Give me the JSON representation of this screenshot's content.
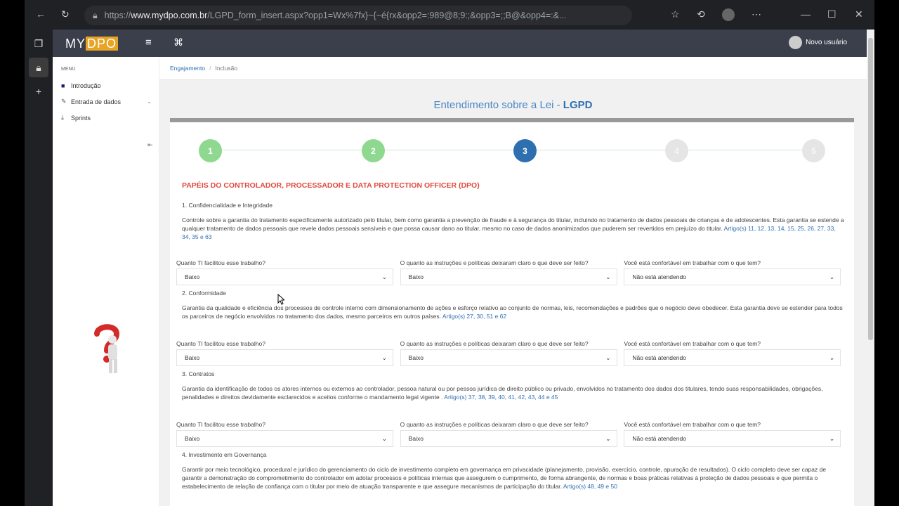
{
  "browser": {
    "url_prefix": "https://",
    "url_host": "www.mydpo.com.br",
    "url_rest": "/LGPD_form_insert.aspx?opp1=Wx%7fx}~{~é{rx&opp2=:989@8;9:;&opp3=;;B@&opp4=:&...",
    "icons": [
      "back-icon",
      "reload-icon",
      "lock-icon",
      "read-aloud-icon",
      "zoom-icon",
      "favorite-icon",
      "extension-icon",
      "favorites-icon",
      "history-icon",
      "profile-icon",
      "more-icon",
      "minimize-icon",
      "maximize-icon",
      "close-icon"
    ]
  },
  "app": {
    "logo_my": "MY",
    "logo_dpo": "DPO",
    "user_name": "Novo usuário"
  },
  "sidebar": {
    "header": "MENU",
    "items": [
      {
        "label": "Introdução",
        "icon": "video-icon"
      },
      {
        "label": "Entrada de dados",
        "icon": "pencil-icon"
      },
      {
        "label": "Sprints",
        "icon": "download-icon"
      }
    ]
  },
  "breadcrumb": {
    "first": "Engajamento",
    "separator": "/",
    "second": "Inclusão"
  },
  "page": {
    "title_main": "Entendimento sobre a Lei - ",
    "title_bold": "LGPD"
  },
  "stepper": {
    "steps": [
      "1",
      "2",
      "3",
      "4",
      "5"
    ],
    "current": 3
  },
  "section_title": "PAPÉIS DO CONTROLADOR, PROCESSADOR E DATA PROTECTION OFFICER (DPO)",
  "questions": {
    "q1": "Quanto TI facilitou esse trabalho?",
    "q2": "O quanto as instruções e políticas deixaram claro o que deve ser feito?",
    "q3": "Você está confortável em trabalhar com o que tem?"
  },
  "sections": [
    {
      "heading": "1. Confidencialidade e Integridade",
      "text": "Controle sobre a garantia do tratamento especificamente autorizado pelo titular, bem como garantia a prevenção de fraude e à segurança do titular, incluindo no tratamento de dados pessoais de crianças e de adolescentes. Esta garantia se estende a qualquer tratamento de dados pessoais que revele dados pessoais sensíveis e que possa causar dano ao titular, mesmo no caso de dados anonimizados que puderem ser revertidos em prejuízo do titular. ",
      "link": "Artigo(s) 11, 12, 13, 14, 15, 25, 26, 27, 33, 34, 35 e 63",
      "answers": [
        "Baixo",
        "Baixo",
        "Não está atendendo"
      ]
    },
    {
      "heading": "2. Conformidade",
      "text": "Garantia da qualidade e eficiência dos processos de controle interno com dimensionamento de ações e esforço relativo ao conjunto de normas, leis, recomendações e padrões que o negócio deve obedecer. Esta garantia deve se estender para todos os parceiros de negócio envolvidos no tratamento dos dados, mesmo parceiros em outros países. ",
      "link": "Artigo(s) 27, 30, 51 e 62",
      "answers": [
        "Baixo",
        "Baixo",
        "Não está atendendo"
      ]
    },
    {
      "heading": "3. Contratos",
      "text": "Garantia da identificação de todos os atores internos ou externos ao controlador, pessoa natural ou por pessoa jurídica de direito público ou privado, envolvidos no tratamento dos dados dos titulares, tendo suas responsabilidades, obrigações, penalidades e direitos devidamente esclarecidos e aceitos conforme o mandamento legal vigente . ",
      "link": "Artigo(s) 37, 38, 39, 40, 41, 42, 43, 44 e 45",
      "answers": [
        "Baixo",
        "Baixo",
        "Não está atendendo"
      ]
    },
    {
      "heading": "4. Investimento em Governança",
      "text": "Garantir por meio tecnológico, procedural e jurídico do gerenciamento do ciclo de investimento completo em governança em privacidade (planejamento, provisão, exercício, controle, apuração de resultados). O ciclo completo deve ser capaz de garantir a demonstração do comprometimento do controlador em adotar processos e políticas internas que assegurem o cumprimento, de forma abrangente, de normas e boas práticas relativas à proteção de dados pessoais e que permita o estabelecimento de relação de confiança com o titular por meio de atuação transparente e que assegure mecanismos de participação do titular. ",
      "link": "Artigo(s) 48, 49 e 50"
    }
  ],
  "colors": {
    "accent": "#2f6fb1",
    "section_title": "#e0493e",
    "step_done": "#8fd88f",
    "step_current": "#2e6fb0",
    "logo": "#e8a423"
  }
}
